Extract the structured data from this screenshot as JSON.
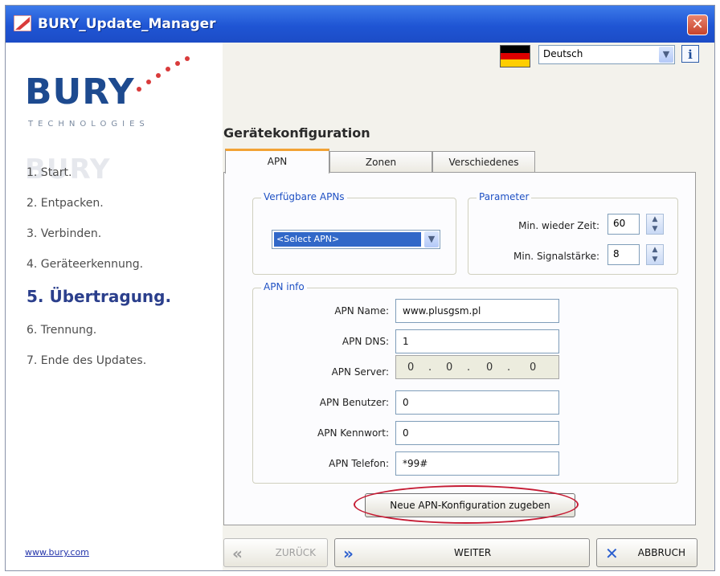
{
  "window": {
    "title": "BURY_Update_Manager"
  },
  "sidebar": {
    "logo_text": "BURY",
    "logo_sub": "TECHNOLOGIES",
    "steps": [
      {
        "label": "1. Start."
      },
      {
        "label": "2. Entpacken."
      },
      {
        "label": "3. Verbinden."
      },
      {
        "label": "4. Geräteerkennung."
      },
      {
        "label": "5. Übertragung."
      },
      {
        "label": "6. Trennung."
      },
      {
        "label": "7. Ende des Updates."
      }
    ],
    "active_step_index": 4,
    "website": "www.bury.com"
  },
  "language": {
    "selected": "Deutsch",
    "flag": "germany-flag-icon",
    "flag_colors": [
      "#000000",
      "#dd0000",
      "#ffce00"
    ]
  },
  "config": {
    "title": "Gerätekonfiguration",
    "tabs": [
      {
        "label": "APN"
      },
      {
        "label": "Zonen"
      },
      {
        "label": "Verschiedenes"
      }
    ],
    "active_tab_index": 0,
    "available_apns": {
      "legend": "Verfügbare APNs",
      "selected": "<Select APN>"
    },
    "parameter": {
      "legend": "Parameter",
      "min_wait_label": "Min. wieder Zeit:",
      "min_wait_value": "60",
      "min_signal_label": "Min. Signalstärke:",
      "min_signal_value": "8"
    },
    "apn_info": {
      "legend": "APN info",
      "name_label": "APN Name:",
      "name_value": "www.plusgsm.pl",
      "dns_label": "APN DNS:",
      "dns_value": "1",
      "server_label": "APN Server:",
      "server_octets": [
        "0",
        "0",
        "0",
        "0"
      ],
      "user_label": "APN Benutzer:",
      "user_value": "0",
      "password_label": "APN Kennwort:",
      "password_value": "0",
      "phone_label": "APN Telefon:",
      "phone_value": "*99#"
    },
    "add_button": "Neue APN-Konfiguration zugeben"
  },
  "nav": {
    "back": "ZURÜCK",
    "next": "WEITER",
    "cancel": "ABBRUCH"
  },
  "colors": {
    "titlebar": "#1f55d4",
    "accent_tab": "#f2a335",
    "legend_text": "#1f51c4",
    "highlight": "#c51b33",
    "active_step": "#2b3f8c"
  }
}
